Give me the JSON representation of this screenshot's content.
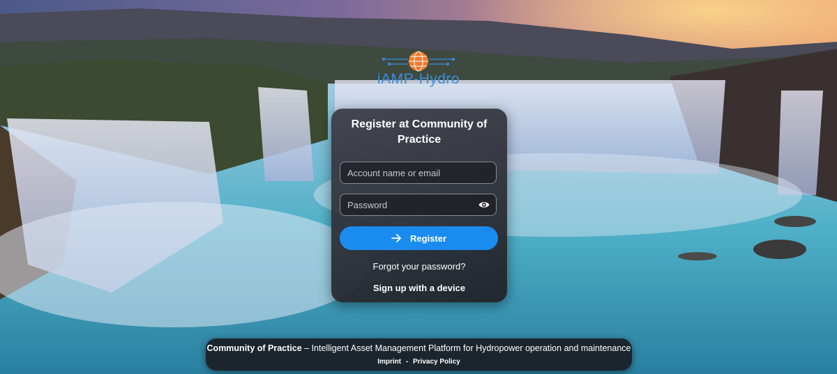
{
  "logo": {
    "text": "iAMP-Hydro",
    "icon": "globe-circuit-logo"
  },
  "card": {
    "title": "Register at Community of Practice",
    "account_placeholder": "Account name or email",
    "password_placeholder": "Password",
    "register_label": "Register",
    "forgot_label": "Forgot your password?",
    "device_label": "Sign up with a device"
  },
  "footer": {
    "brand": "Community of Practice",
    "tagline": " – Intelligent Asset Management Platform for Hydropower operation and maintenance",
    "imprint": "Imprint",
    "separator": "-",
    "privacy": "Privacy Policy"
  },
  "colors": {
    "accent": "#1a8cf0",
    "logo_blue": "#3a8dde",
    "logo_orange": "#f07a2a"
  }
}
